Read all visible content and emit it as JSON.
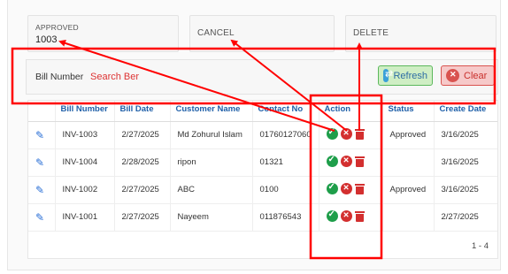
{
  "cards": {
    "approved": {
      "label": "APPROVED",
      "value": "1003"
    },
    "cancel": {
      "label": "CANCEL"
    },
    "delete": {
      "label": "DELETE"
    }
  },
  "search": {
    "label": "Bill Number",
    "placeholder": "Search Ber",
    "refresh_label": "Refresh",
    "clear_label": "Clear"
  },
  "table": {
    "headers": [
      "Bill Number",
      "Bill Date",
      "Customer Name",
      "Contact No",
      "Action",
      "Status",
      "Create Date"
    ],
    "rows": [
      {
        "bill": "INV-1003",
        "date": "2/27/2025",
        "customer": "Md Zohurul Islam",
        "contact": "01760127060",
        "status": "Approved",
        "created": "3/16/2025"
      },
      {
        "bill": "INV-1004",
        "date": "2/28/2025",
        "customer": "ripon",
        "contact": "01321",
        "status": "",
        "created": "3/16/2025"
      },
      {
        "bill": "INV-1002",
        "date": "2/27/2025",
        "customer": "ABC",
        "contact": "0100",
        "status": "Approved",
        "created": "3/16/2025"
      },
      {
        "bill": "INV-1001",
        "date": "2/27/2025",
        "customer": "Nayeem",
        "contact": "011876543",
        "status": "",
        "created": "2/27/2025"
      }
    ],
    "pager": "1 - 4"
  },
  "colors": {
    "annotation": "#ff0000",
    "header_text": "#1f5fa8",
    "approve": "#1e9e4a",
    "cancel": "#d32f2f"
  }
}
